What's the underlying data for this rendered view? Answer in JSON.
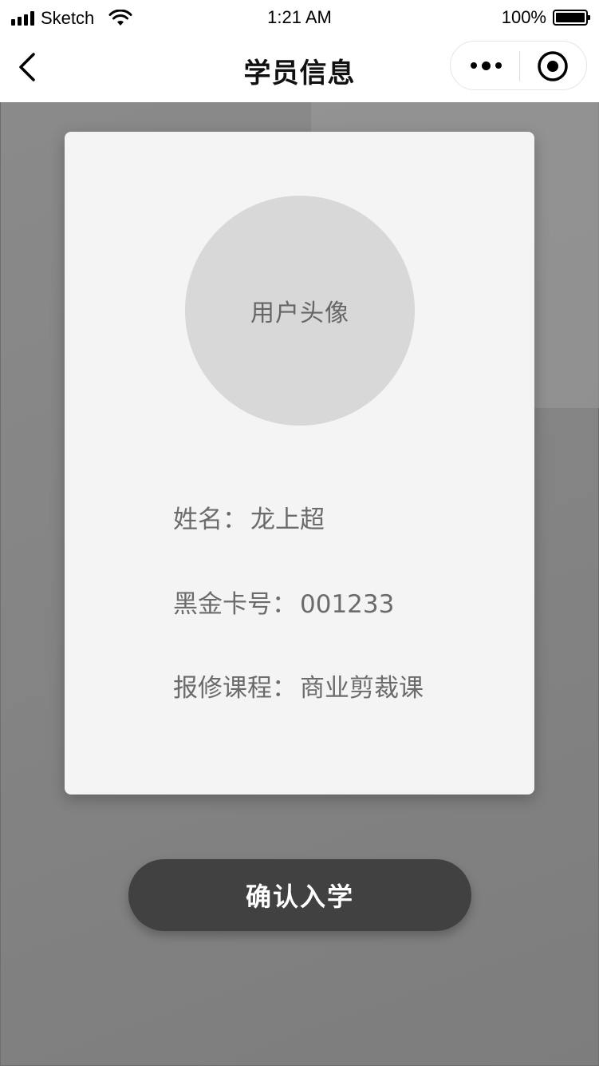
{
  "status_bar": {
    "carrier": "Sketch",
    "time": "1:21 AM",
    "battery_text": "100%"
  },
  "nav": {
    "title": "学员信息",
    "icons": [
      "chevron-left-icon",
      "more-dots-icon",
      "close-target-icon"
    ]
  },
  "card": {
    "avatar_label": "用户头像",
    "fields": [
      {
        "label": "姓名：",
        "value": "龙上超"
      },
      {
        "label": "黑金卡号：",
        "value": "001233"
      },
      {
        "label": "报修课程：",
        "value": "商业剪裁课"
      }
    ]
  },
  "actions": {
    "confirm_label": "确认入学"
  },
  "colors": {
    "background": "#858585",
    "card": "#f4f4f4",
    "avatar": "#d8d8d8",
    "button": "#414141"
  }
}
